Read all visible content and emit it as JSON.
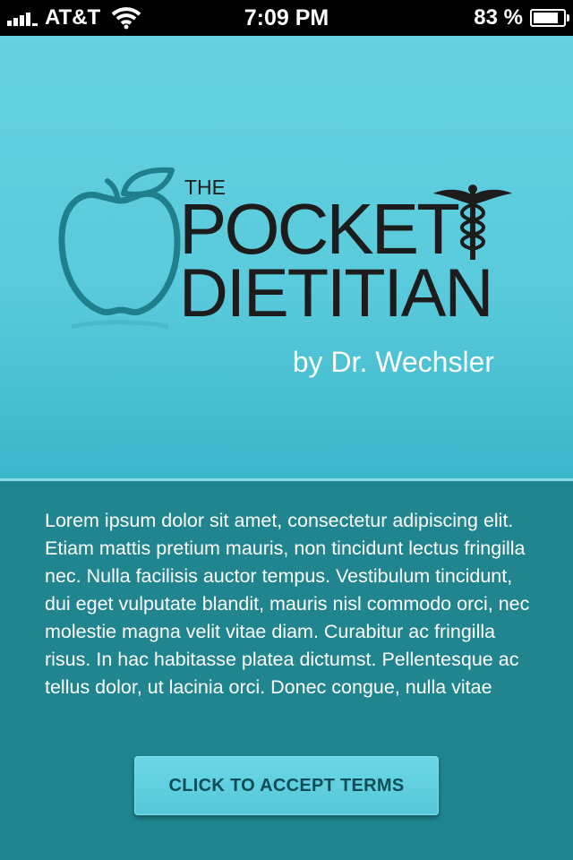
{
  "status_bar": {
    "carrier": "AT&T",
    "time": "7:09 PM",
    "battery_percent_label": "83 %",
    "battery_level": 0.83,
    "icons": [
      "signal-icon",
      "wifi-icon",
      "battery-icon"
    ]
  },
  "header": {
    "logo": {
      "the": "THE",
      "pocket": "POCKET",
      "dietitian": "DIETITIAN",
      "icons": [
        "apple-icon",
        "caduceus-icon"
      ]
    },
    "byline": "by Dr. Wechsler"
  },
  "terms": {
    "text": "Lorem ipsum dolor sit amet, consectetur adipiscing elit. Etiam mattis pretium mauris, non tincidunt lectus fringilla nec. Nulla facilisis auctor tempus. Vestibulum tincidunt, dui eget vulputate blandit, mauris nisl commodo orci, nec molestie magna velit vitae diam. Curabitur ac fringilla risus. In hac habitasse platea dictumst. Pellentesque ac tellus dolor, ut lacinia orci. Donec congue, nulla vitae",
    "accept_label": "CLICK TO ACCEPT TERMS"
  },
  "colors": {
    "header_top": "#63d1df",
    "header_bottom": "#3bb6cb",
    "body_bg": "#20858f",
    "logo_dark": "#1c1c1c",
    "apple_stroke": "#1f7f8c",
    "button_bg": "#5fcfdf",
    "button_text": "#0c4d56"
  }
}
